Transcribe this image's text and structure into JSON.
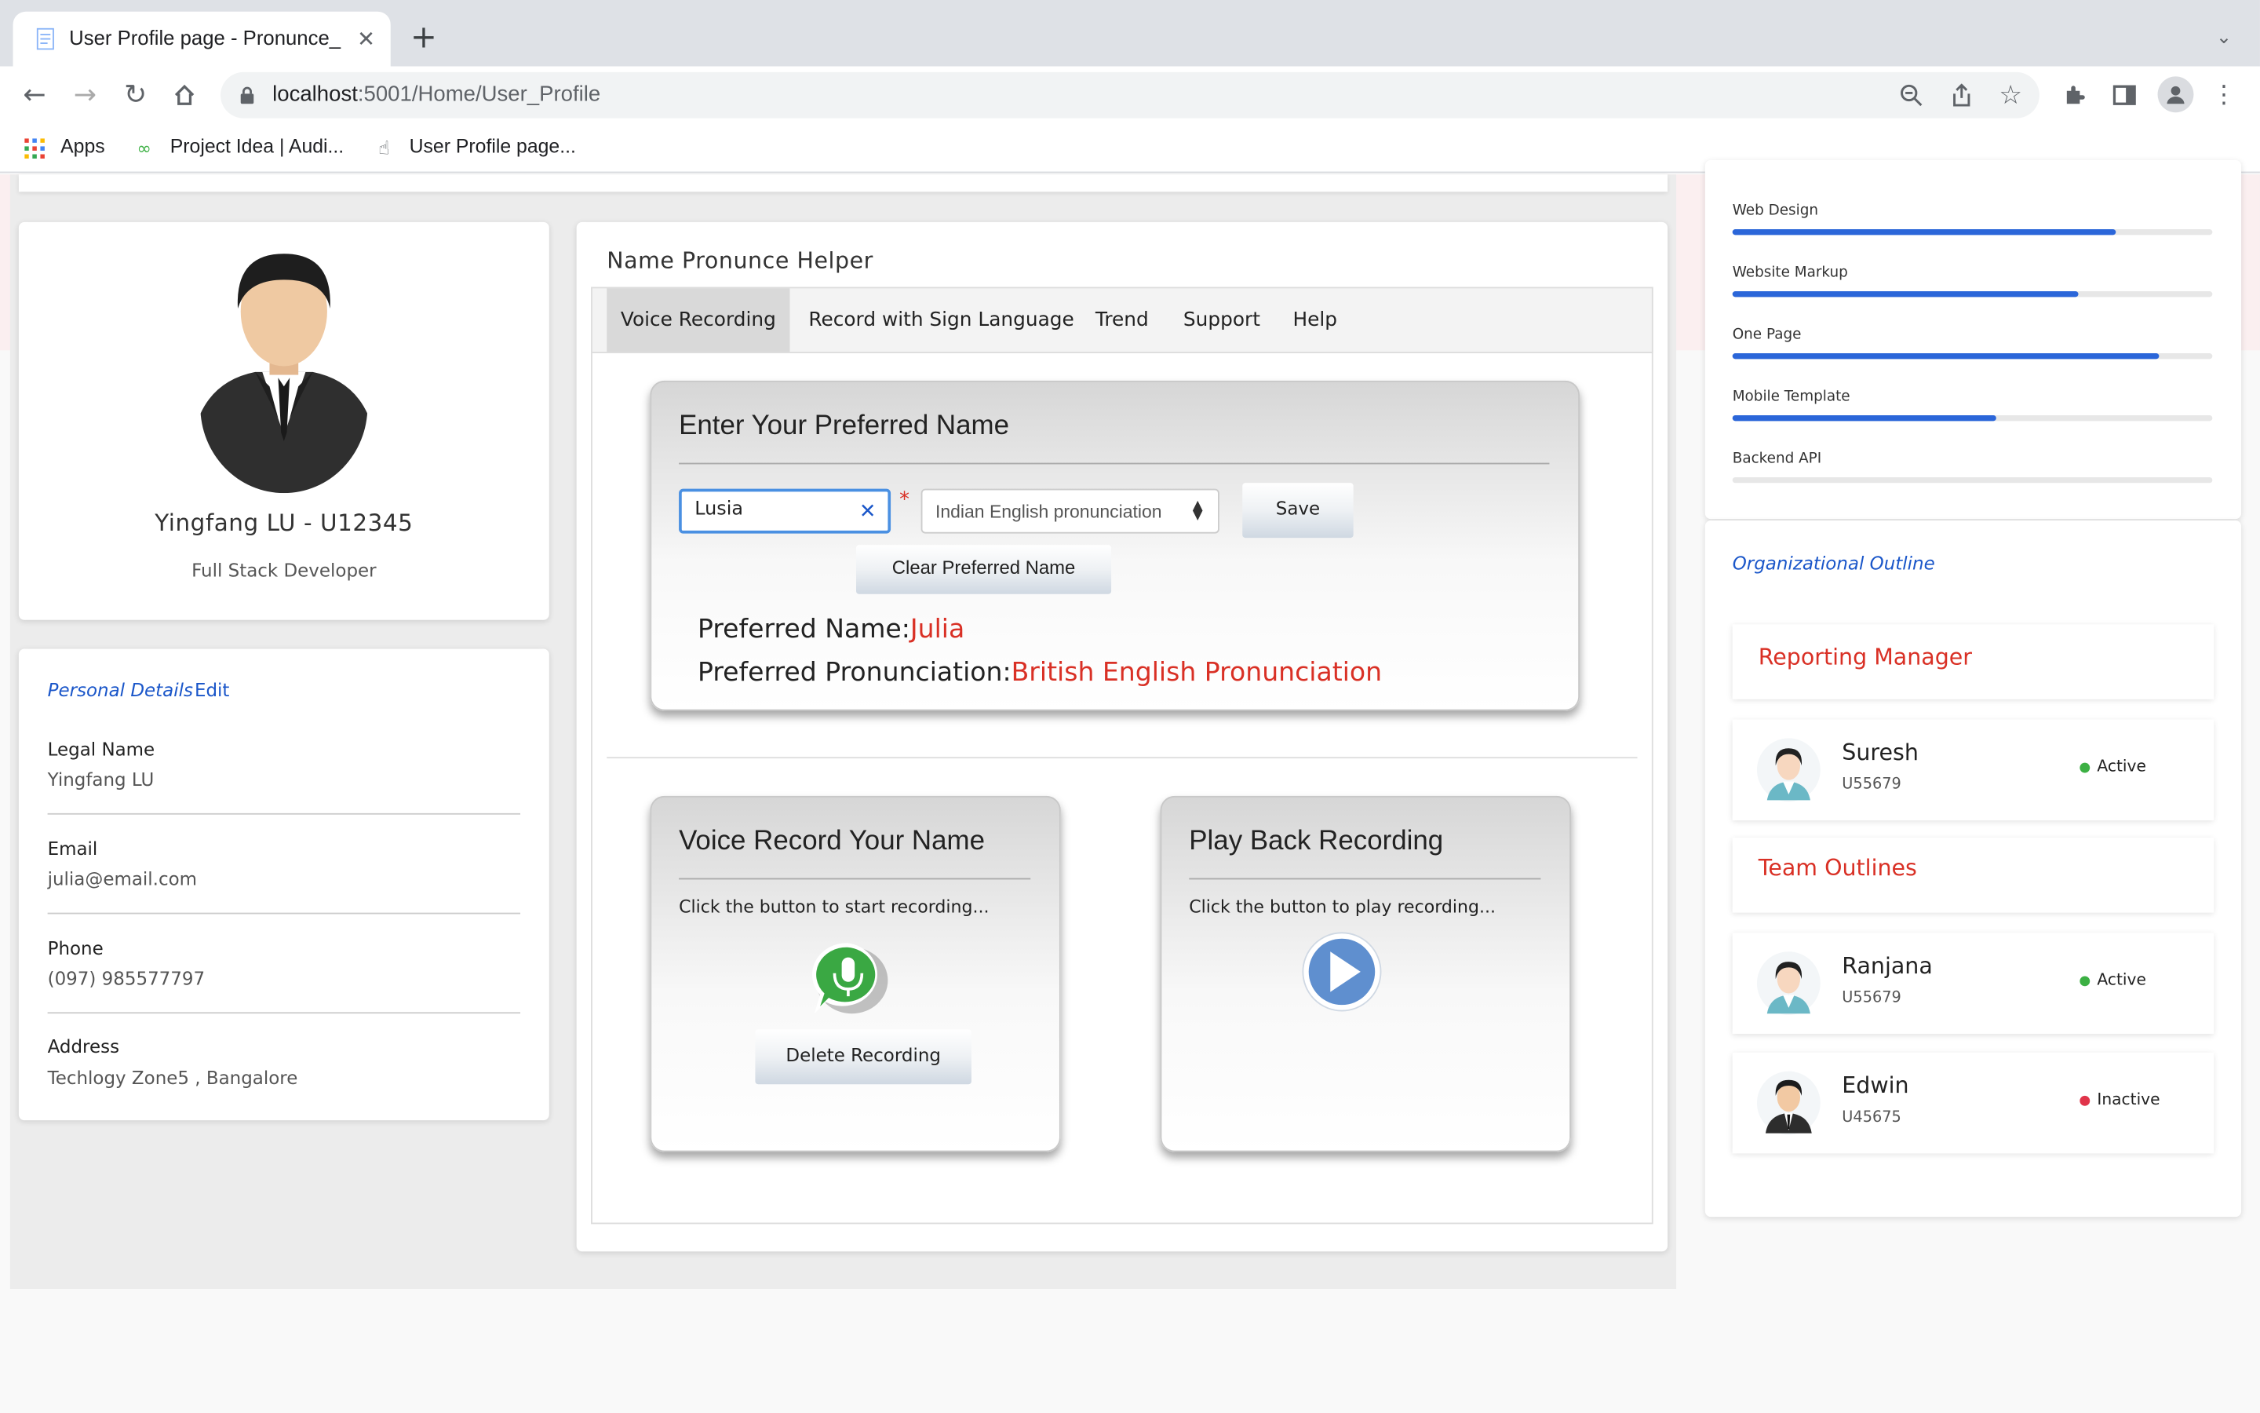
{
  "browser": {
    "tab_title": "User Profile page - Pronunce_",
    "url_host": "localhost",
    "url_rest": ":5001/Home/User_Profile",
    "bookmarks": [
      "Apps",
      "Project Idea | Audi...",
      "User Profile page..."
    ]
  },
  "profile": {
    "name": "Yingfang LU - U12345",
    "role": "Full Stack Developer"
  },
  "personal": {
    "title": "Personal Details",
    "edit": "Edit",
    "fields": [
      {
        "label": "Legal Name",
        "value": "Yingfang LU"
      },
      {
        "label": "Email",
        "value": "julia@email.com"
      },
      {
        "label": "Phone",
        "value": "(097) 985577797"
      },
      {
        "label": "Address",
        "value": "Techlogy Zone5 , Bangalore"
      }
    ]
  },
  "helper": {
    "title": "Name Pronunce Helper",
    "tabs": [
      "Voice Recording",
      "Record with Sign Language",
      "Trend",
      "Support",
      "Help"
    ],
    "preferred_panel": {
      "heading": "Enter Your Preferred Name",
      "name_input_value": "Lusia",
      "required_mark": "*",
      "pronunciation_select": "Indian English pronunciation",
      "save_label": "Save",
      "clear_label": "Clear Preferred Name",
      "preferred_name_label": "Preferred Name:",
      "preferred_name_value": "Julia",
      "preferred_pron_label": "Preferred Pronunciation:",
      "preferred_pron_value": "British English Pronunciation"
    },
    "record_panel": {
      "heading": "Voice Record Your Name",
      "hint": "Click the button to start recording...",
      "delete_label": "Delete Recording"
    },
    "playback_panel": {
      "heading": "Play Back Recording",
      "hint": "Click the button to play recording..."
    }
  },
  "skills": [
    {
      "label": "Web Design",
      "level": 0.8
    },
    {
      "label": "Website Markup",
      "level": 0.72
    },
    {
      "label": "One Page",
      "level": 0.89
    },
    {
      "label": "Mobile Template",
      "level": 0.55
    },
    {
      "label": "Backend API",
      "level": 0.0
    }
  ],
  "org": {
    "title": "Organizational Outline",
    "manager_heading": "Reporting Manager",
    "team_heading": "Team Outlines",
    "manager": {
      "name": "Suresh",
      "id": "U55679",
      "status": "Active"
    },
    "team": [
      {
        "name": "Ranjana",
        "id": "U55679",
        "status": "Active"
      },
      {
        "name": "Edwin",
        "id": "U45675",
        "status": "Inactive"
      }
    ],
    "colors": {
      "active": "#3cb043",
      "inactive": "#e0344a",
      "accent_red": "#d93025",
      "link_blue": "#1a56c9"
    }
  }
}
